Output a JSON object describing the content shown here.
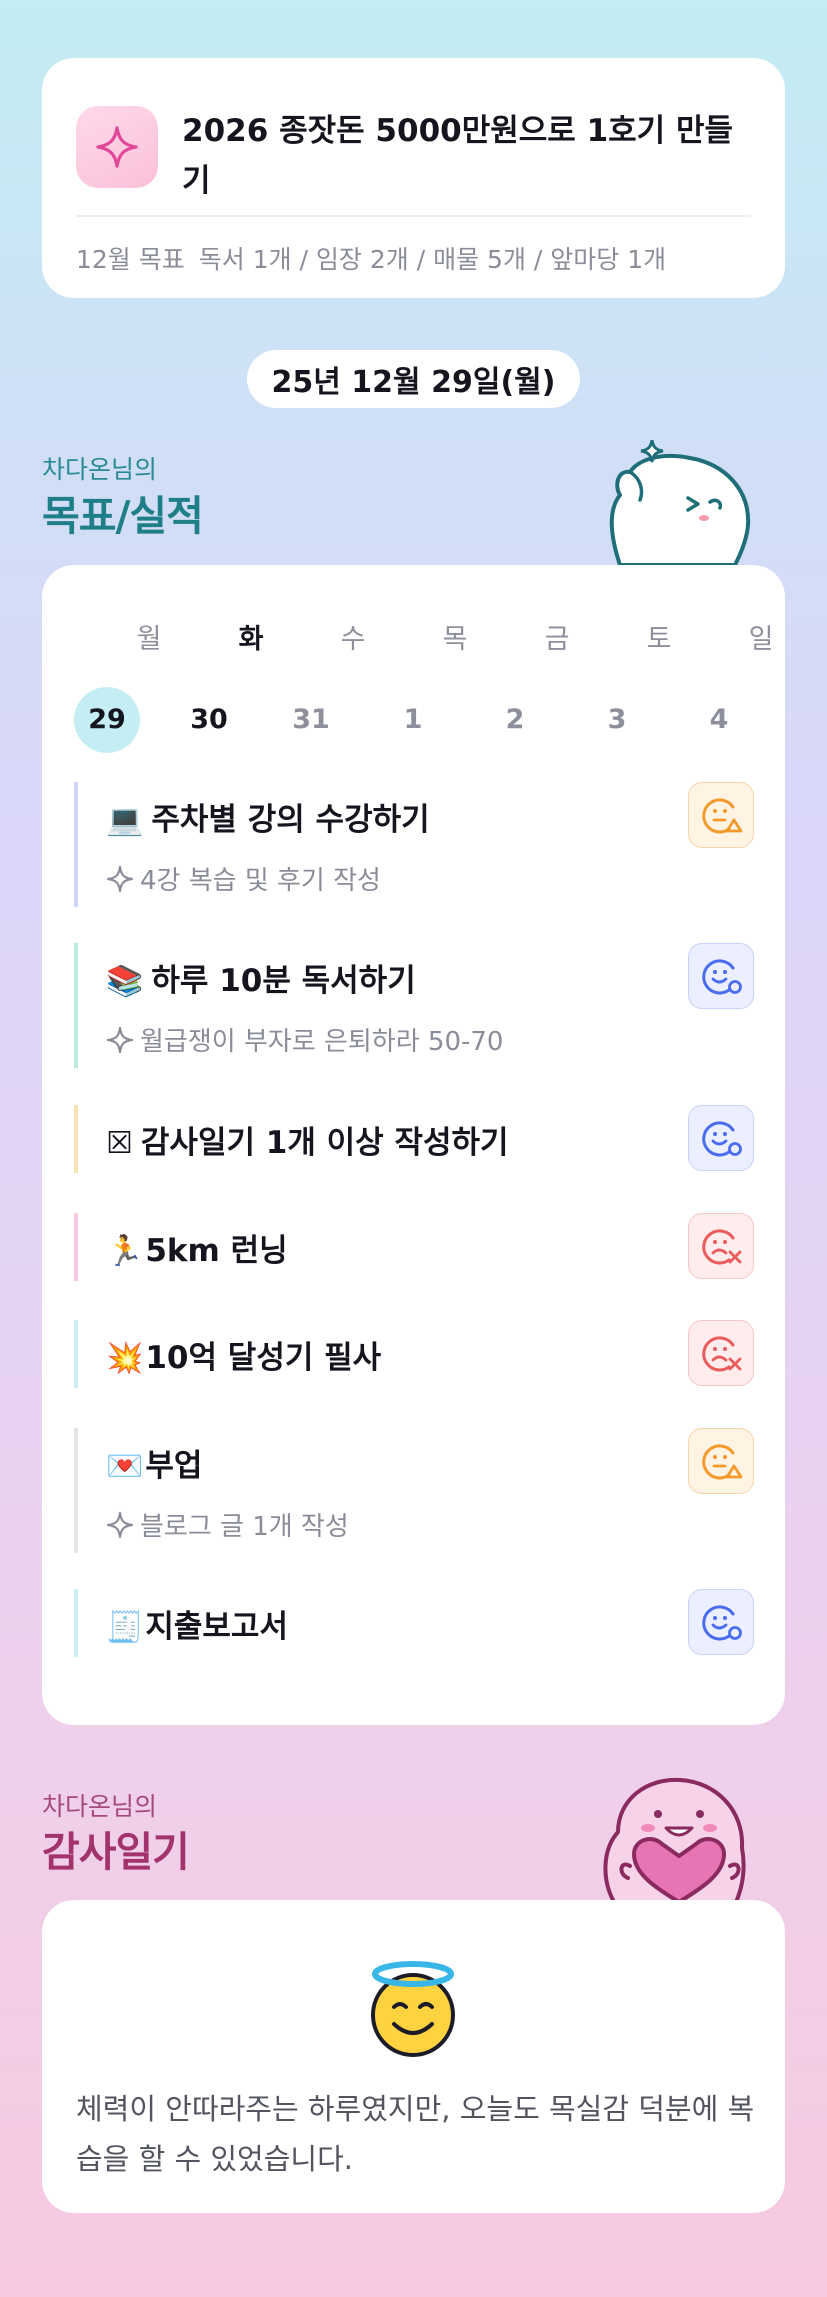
{
  "goal": {
    "title": "2026 종잣돈 5000만원으로 1호기 만들기",
    "month_label": "12월 목표",
    "month_goals": "독서 1개 / 임장 2개 / 매물 5개 / 앞마당 1개"
  },
  "date": "25년 12월 29일(월)",
  "goals_section": {
    "subtitle": "차다온님의",
    "title": "목표/실적"
  },
  "week": {
    "days": [
      {
        "name": "월",
        "num": "29"
      },
      {
        "name": "화",
        "num": "30"
      },
      {
        "name": "수",
        "num": "31"
      },
      {
        "name": "목",
        "num": "1"
      },
      {
        "name": "금",
        "num": "2"
      },
      {
        "name": "토",
        "num": "3"
      },
      {
        "name": "일",
        "num": "4"
      }
    ]
  },
  "tasks": [
    {
      "emoji": "💻",
      "title": "주차별 강의 수강하기",
      "sub": "4강 복습 및 후기 작성",
      "status": "triangle",
      "bar_color": "#cfd6f5"
    },
    {
      "emoji": "📚",
      "title": "하루 10분 독서하기",
      "sub": "월급쟁이 부자로 은퇴하라 50-70",
      "status": "circle",
      "bar_color": "#b9ecd9"
    },
    {
      "emoji": "☒",
      "title": "감사일기 1개 이상 작성하기",
      "sub": "",
      "status": "circle",
      "bar_color": "#f8e2b4"
    },
    {
      "emoji": "🏃",
      "title": "5km 런닝",
      "sub": "",
      "status": "x",
      "bar_color": "#f7c9e3"
    },
    {
      "emoji": "💥",
      "title": "10억 달성기 필사",
      "sub": "",
      "status": "x",
      "bar_color": "#c9eef2"
    },
    {
      "emoji": "💌",
      "title": "부업",
      "sub": "블로그 글 1개 작성",
      "status": "triangle",
      "bar_color": "#e6e6ea"
    },
    {
      "emoji": "🧾",
      "title": "지출보고서",
      "sub": "",
      "status": "circle",
      "bar_color": "#c9eef2"
    }
  ],
  "diary_section": {
    "subtitle": "차다온님의",
    "title": "감사일기"
  },
  "diary": {
    "text": "체력이 안따라주는 하루였지만, 오늘도 목실감 덕분에 복습을 할 수 있었습니다."
  },
  "colors": {
    "teal": "#1f7f89",
    "magenta": "#a2336d",
    "status_triangle": "#f39a2b",
    "status_circle": "#4a6cf0",
    "status_x": "#ea5b5b"
  }
}
